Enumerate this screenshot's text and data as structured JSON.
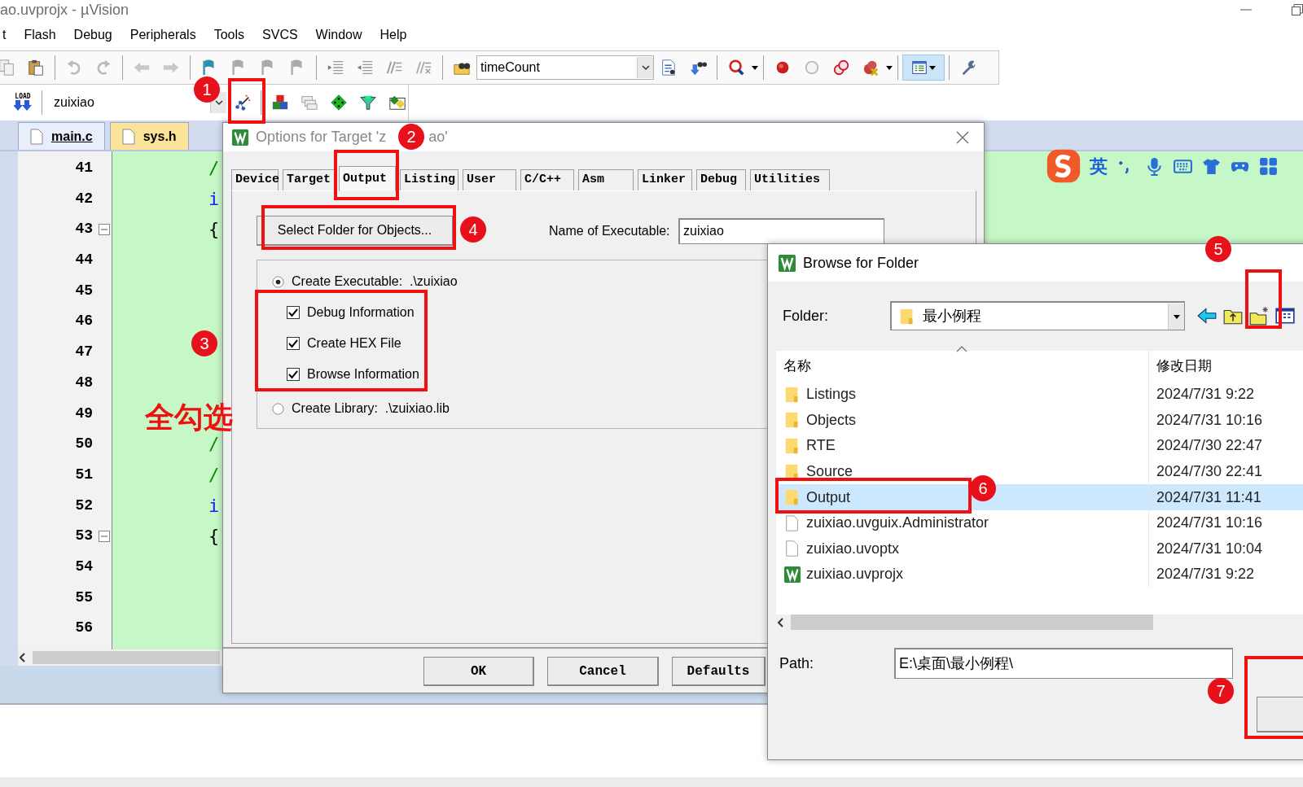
{
  "window": {
    "title": "ao.uvprojx - µVision"
  },
  "menu": [
    "t",
    "Flash",
    "Debug",
    "Peripherals",
    "Tools",
    "SVCS",
    "Window",
    "Help"
  ],
  "toolbar": {
    "find_combo": "timeCount",
    "window_layout_on": true
  },
  "build_toolbar": {
    "load_label": "LOAD",
    "target_combo": "zuixiao"
  },
  "editor": {
    "tabs": [
      {
        "label": "main.c",
        "selected": true
      },
      {
        "label": "sys.h",
        "selected": false
      }
    ],
    "lines": [
      {
        "number": "41",
        "code": "/",
        "kind": "comment",
        "foldable": false
      },
      {
        "number": "42",
        "code": "i",
        "kind": "keyword",
        "foldable": false
      },
      {
        "number": "43",
        "code": "{",
        "kind": "brace",
        "foldable": true
      },
      {
        "number": "44",
        "foldable": false
      },
      {
        "number": "45",
        "foldable": false
      },
      {
        "number": "46",
        "foldable": false
      },
      {
        "number": "47",
        "foldable": false
      },
      {
        "number": "48",
        "foldable": false
      },
      {
        "number": "49",
        "foldable": false
      },
      {
        "number": "50",
        "code": "/",
        "kind": "comment",
        "foldable": false
      },
      {
        "number": "51",
        "code": "/",
        "kind": "comment",
        "foldable": false
      },
      {
        "number": "52",
        "code": "i",
        "kind": "keyword",
        "foldable": false
      },
      {
        "number": "53",
        "code": "{",
        "kind": "brace",
        "foldable": true
      },
      {
        "number": "54",
        "foldable": false
      },
      {
        "number": "55",
        "foldable": false
      },
      {
        "number": "56",
        "foldable": false
      }
    ]
  },
  "options_dialog": {
    "title_start": "Options for Target 'z",
    "title_end": "ao'",
    "tabs": [
      {
        "label": "Device",
        "selected": false
      },
      {
        "label": "Target",
        "selected": false
      },
      {
        "label": "Output",
        "selected": true
      },
      {
        "label": "Listing",
        "selected": false
      },
      {
        "label": "User",
        "selected": false
      },
      {
        "label": "C/C++",
        "selected": false
      },
      {
        "label": "Asm",
        "selected": false
      },
      {
        "label": "Linker",
        "selected": false
      },
      {
        "label": "Debug",
        "selected": false
      },
      {
        "label": "Utilities",
        "selected": false
      }
    ],
    "select_folder_button": "Select Folder for Objects...",
    "executable_label": "Name of Executable:",
    "executable_name": "zuixiao",
    "create_executable": {
      "label": "Create Executable:  .\\zuixiao",
      "selected": true
    },
    "checkboxes": [
      {
        "label": "Debug Information",
        "checked": true
      },
      {
        "label": "Create HEX File",
        "checked": true
      },
      {
        "label": "Browse Information",
        "checked": true
      }
    ],
    "create_library": {
      "label": "Create Library:  .\\zuixiao.lib",
      "selected": false
    },
    "buttons": [
      "OK",
      "Cancel",
      "Defaults"
    ]
  },
  "ime_bar": {
    "mode": "英"
  },
  "browse_dialog": {
    "title": "Browse for Folder",
    "folder_label": "Folder:",
    "folder": "最小例程",
    "columns": [
      "名称",
      "修改日期"
    ],
    "rows": [
      {
        "name": "Listings",
        "date": "2024/7/31 9:22",
        "kind": "folder",
        "selected": false
      },
      {
        "name": "Objects",
        "date": "2024/7/31 10:16",
        "kind": "folder",
        "selected": false
      },
      {
        "name": "RTE",
        "date": "2024/7/30 22:47",
        "kind": "folder",
        "selected": false
      },
      {
        "name": "Source",
        "date": "2024/7/30 22:41",
        "kind": "folder",
        "selected": false
      },
      {
        "name": "Output",
        "date": "2024/7/31 11:41",
        "kind": "folder",
        "selected": true
      },
      {
        "name": "zuixiao.uvguix.Administrator",
        "date": "2024/7/31 10:16",
        "kind": "file",
        "selected": false
      },
      {
        "name": "zuixiao.uvoptx",
        "date": "2024/7/31 10:04",
        "kind": "file",
        "selected": false
      },
      {
        "name": "zuixiao.uvprojx",
        "date": "2024/7/31 9:22",
        "kind": "project",
        "selected": false
      }
    ],
    "path_label": "Path:",
    "path": "E:\\桌面\\最小例程\\"
  },
  "annotations": {
    "steps": [
      "1",
      "2",
      "3",
      "4",
      "5",
      "6",
      "7"
    ],
    "note": "全勾选"
  }
}
